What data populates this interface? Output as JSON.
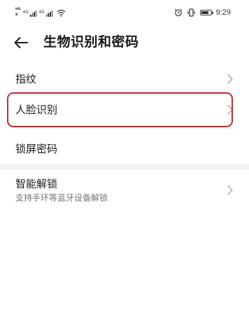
{
  "status_bar": {
    "sim1_badge_top": "HD",
    "sim1_badge_bottom": "B",
    "sim1_label": "4G",
    "sim2_label": "4G",
    "time": "9:29",
    "battery_level": 0.85,
    "icons": [
      "hd-badge-icon",
      "signal-icon",
      "wifi-icon",
      "alarm-icon",
      "vibrate-icon",
      "battery-icon"
    ]
  },
  "header": {
    "back_icon": "arrow-left-icon",
    "title": "生物识别和密码"
  },
  "settings": {
    "items": [
      {
        "label": "指纹",
        "chevron": "chevron-right-icon"
      },
      {
        "label": "人脸识别",
        "chevron": "chevron-right-icon",
        "highlighted": true
      },
      {
        "label": "锁屏密码"
      },
      {
        "label": "智能解锁",
        "sublabel": "支持手环等蓝牙设备解锁",
        "chevron": "chevron-right-icon"
      }
    ]
  },
  "colors": {
    "highlight": "#c42b2f",
    "text": "#1a1a1a",
    "subtext": "#777777",
    "section_gap": "#f1f1f1"
  }
}
